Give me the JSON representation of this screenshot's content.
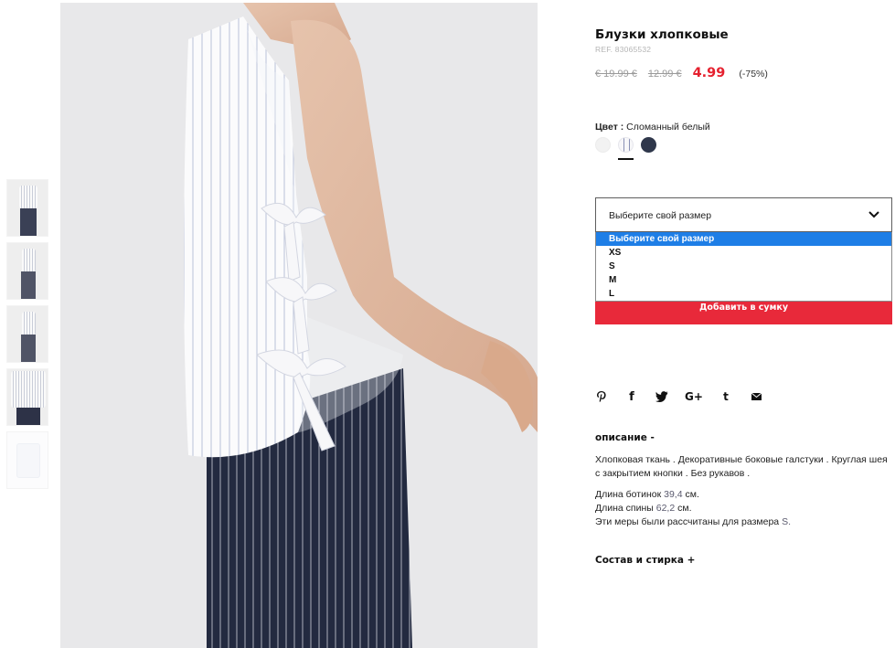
{
  "product": {
    "title": "Блузки хлопковые",
    "ref": "REF. 83065532",
    "original_price": "€ 19.99 €",
    "previous_price": "12.99 €",
    "sale_price": "4.99",
    "discount": "(-75%)"
  },
  "color": {
    "label": "Цвет :",
    "value": "Сломанный белый",
    "swatches": [
      "white",
      "stripe",
      "navy"
    ],
    "selected_index": 1
  },
  "size": {
    "placeholder": "Выберите свой размер",
    "options": [
      "Выберите свой размер",
      "XS",
      "S",
      "M",
      "L"
    ],
    "selected_index": 0
  },
  "cart": {
    "add_label": "Добавить в сумку"
  },
  "social": [
    "pinterest-icon",
    "facebook-icon",
    "twitter-icon",
    "google-plus-icon",
    "tumblr-icon",
    "email-icon"
  ],
  "description": {
    "heading": "описание  -",
    "text": "Хлопковая ткань . Декоративные боковые галстуки . Круглая шея с закрытием кнопки . Без рукавов .",
    "measures": {
      "boot_length_label": "Длина ботинок",
      "boot_length_value": "39,4",
      "boot_length_unit": "см.",
      "back_length_label": "Длина спины",
      "back_length_value": "62,2",
      "back_length_unit": "см.",
      "size_note_label": "Эти меры были рассчитаны для размера",
      "size_note_value": "S."
    }
  },
  "composition": {
    "heading": "Состав и стирка  +"
  },
  "colors": {
    "accent_red": "#e8293a",
    "price_red": "#e5202e",
    "select_blue": "#1e7ee6",
    "navy": "#2f374b"
  }
}
